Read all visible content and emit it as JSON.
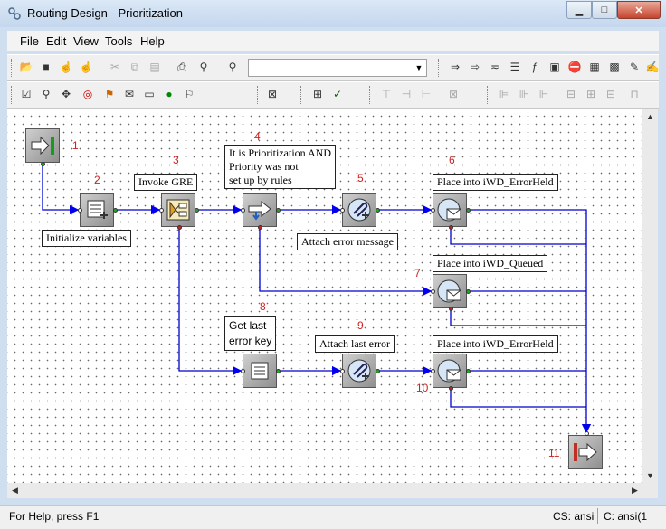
{
  "window": {
    "title": "Routing Design - Prioritization"
  },
  "window_controls": {
    "minimize": "▁",
    "maximize": "□",
    "close": "✕"
  },
  "menu": [
    "File",
    "Edit",
    "View",
    "Tools",
    "Help"
  ],
  "combo": {
    "value": ""
  },
  "nodes": [
    {
      "num": "1",
      "label": "",
      "icon": "entry-icon"
    },
    {
      "num": "2",
      "label": "Initialize variables",
      "icon": "assign-icon"
    },
    {
      "num": "3",
      "label": "Invoke GRE",
      "icon": "gre-icon"
    },
    {
      "num": "4",
      "label_lines": [
        "It is Prioritization AND",
        "Priority was not",
        "set up by rules"
      ],
      "icon": "branch-icon"
    },
    {
      "num": "5",
      "label": "Attach error message",
      "icon": "attach-icon"
    },
    {
      "num": "6",
      "label": "Place into iWD_ErrorHeld",
      "icon": "queue-icon"
    },
    {
      "num": "7",
      "label": "Place into iWD_Queued",
      "icon": "queue-icon"
    },
    {
      "num": "8",
      "label_lines": [
        "Get last",
        "error key"
      ],
      "icon": "assign-icon"
    },
    {
      "num": "9",
      "label": "Attach last error",
      "icon": "attach-icon"
    },
    {
      "num": "10",
      "label": "Place into iWD_ErrorHeld",
      "icon": "queue-icon"
    },
    {
      "num": "11",
      "label": "",
      "icon": "exit-icon"
    }
  ],
  "status": {
    "help": "For Help, press F1",
    "cs": "CS: ansi",
    "c": "C: ansi(1"
  }
}
